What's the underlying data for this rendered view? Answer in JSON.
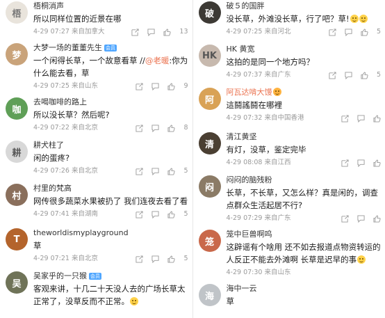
{
  "left": [
    {
      "name": "梧桐消声",
      "vip": false,
      "text": "所以同样位置的近景在哪",
      "time": "4-29 07:27",
      "src": "来自加拿大",
      "likes": "13"
    },
    {
      "name": "大梦一场的董董先生",
      "vip": true,
      "vip_label": "会员",
      "text_pre": "一个闲得长草，一个故意看草 //",
      "mention": "@老暖",
      "text_post": ":你为什么能去看，草",
      "time": "4-29 07:25",
      "src": "来自山东",
      "likes": "9"
    },
    {
      "name": "去喝咖啡的路上",
      "vip": false,
      "text": "所以没长草？然后呢?",
      "time": "4-29 07:22",
      "src": "来自北京",
      "likes": "8"
    },
    {
      "name": "耕犬柱了",
      "vip": false,
      "text": "闲的蛋疼?",
      "time": "4-29 07:26",
      "src": "来自北京",
      "likes": "5"
    },
    {
      "name": "村里的梵高",
      "vip": false,
      "text": "网传很多蔬菜水果被扔了 我们连夜去看了看",
      "time": "4-29 07:41",
      "src": "来自湖南",
      "likes": "5"
    },
    {
      "name": "theworldismyplayground",
      "vip": false,
      "text": "草",
      "time": "4-29 07:21",
      "src": "来自北京",
      "likes": "5"
    },
    {
      "name": "吴家乎的一只猴",
      "vip": true,
      "vip_label": "会员",
      "text": "客观来讲，十几二十天没人去的广场长草太正常了，没草反而不正常。",
      "time": "",
      "src": "",
      "likes": ""
    }
  ],
  "right": [
    {
      "name": "破５的国胖",
      "vip": false,
      "text": "没长草，外滩没长草，行了吧？草!",
      "time": "4-29 07:25",
      "src": "来自河北",
      "likes": "5"
    },
    {
      "name": "HK 黄宽",
      "vip": false,
      "text": "这拍的是同一个地方吗？",
      "time": "4-29 07:37",
      "src": "来自广东",
      "likes": "5"
    },
    {
      "name": "阿瓦达啃大馒",
      "vip": false,
      "orange": true,
      "badge": "",
      "text": "這鬪謠鬪在哪裡",
      "time": "4-29 07:32",
      "src": "来自中国香港",
      "likes": ""
    },
    {
      "name": "清江黄坚",
      "vip": false,
      "text": "有灯，没草，鉴定完毕",
      "time": "4-29 08:08",
      "src": "来自江西",
      "likes": ""
    },
    {
      "name": "闷闷的脑残粉",
      "vip": false,
      "text": "长草，不长草，又怎么样？真是闲的，调查点群众生活起居不行?",
      "time": "4-29 07:29",
      "src": "来自广东",
      "likes": ""
    },
    {
      "name": "笼中巨兽啊呜",
      "vip": false,
      "text": "这辟谣有个啥用 还不如去报道点物资转运的人反正不能去外滩啊 长草是迟早的事",
      "time": "4-29 07:30",
      "src": "来自山东",
      "likes": ""
    },
    {
      "name": "海中一云",
      "vip": false,
      "text": "草",
      "time": "",
      "src": "",
      "likes": ""
    }
  ]
}
